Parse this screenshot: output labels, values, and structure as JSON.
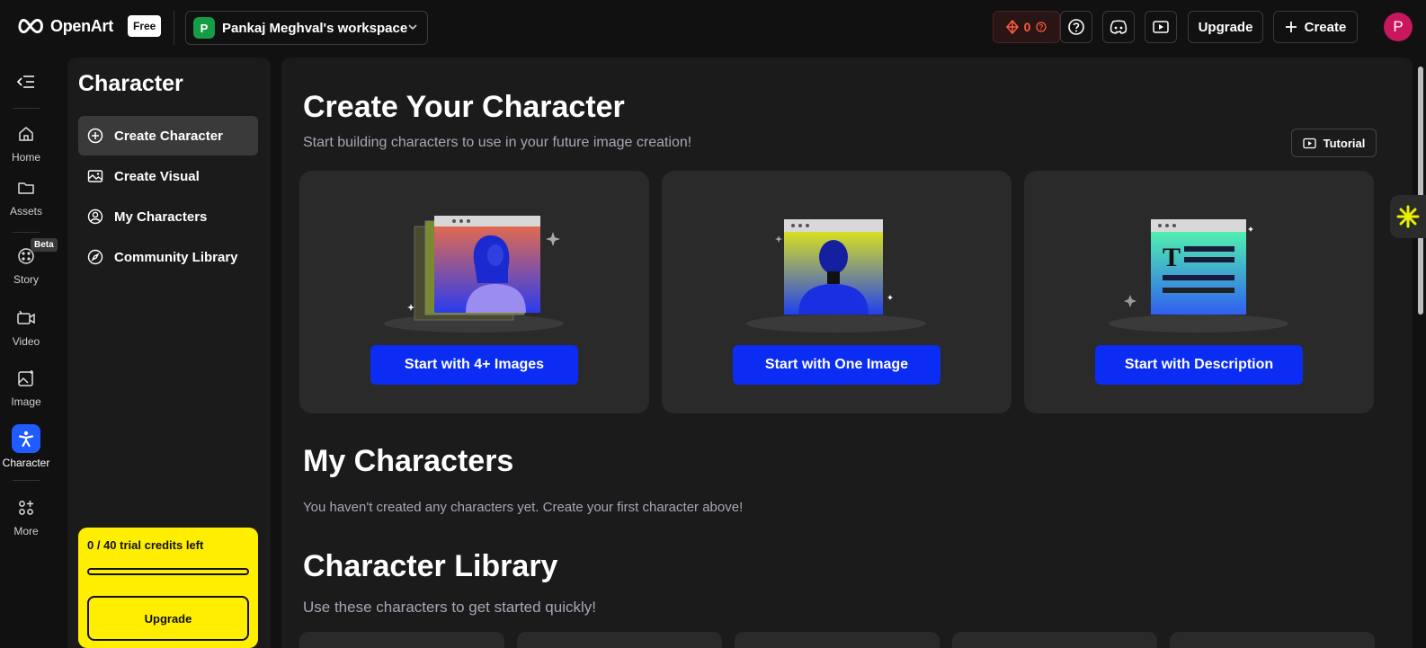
{
  "topbar": {
    "brand": "OpenArt",
    "plan_badge": "Free",
    "workspace_initial": "P",
    "workspace_name": "Pankaj Meghval's workspace",
    "credits": "0",
    "upgrade_label": "Upgrade",
    "create_label": "Create",
    "user_initial": "P"
  },
  "rail": {
    "items": [
      {
        "label": "Home"
      },
      {
        "label": "Assets"
      },
      {
        "label": "Story"
      },
      {
        "label": "Video"
      },
      {
        "label": "Image"
      },
      {
        "label": "Character"
      },
      {
        "label": "More"
      }
    ],
    "beta_badge": "Beta"
  },
  "panel": {
    "title": "Character",
    "items": [
      {
        "label": "Create Character",
        "icon": "plus-circle-icon"
      },
      {
        "label": "Create Visual",
        "icon": "image-icon"
      },
      {
        "label": "My Characters",
        "icon": "user-circle-icon"
      },
      {
        "label": "Community Library",
        "icon": "compass-icon"
      }
    ],
    "trial_text": "0 / 40 trial credits left",
    "trial_progress": 0,
    "trial_button": "Upgrade"
  },
  "main": {
    "title": "Create Your Character",
    "subtitle": "Start building characters to use in your future image creation!",
    "tutorial_label": "Tutorial",
    "cards": [
      {
        "cta": "Start with 4+ Images"
      },
      {
        "cta": "Start with One Image"
      },
      {
        "cta": "Start with Description"
      }
    ],
    "my_characters_title": "My Characters",
    "my_characters_empty": "You haven't created any characters yet. Create your first character above!",
    "library_title": "Character Library",
    "library_subtitle": "Use these characters to get started quickly!"
  },
  "colors": {
    "accent": "#0b2cf3",
    "active_rail": "#1f5bff",
    "trial_bg": "#ffee00",
    "credits": "#ff5a3c"
  }
}
